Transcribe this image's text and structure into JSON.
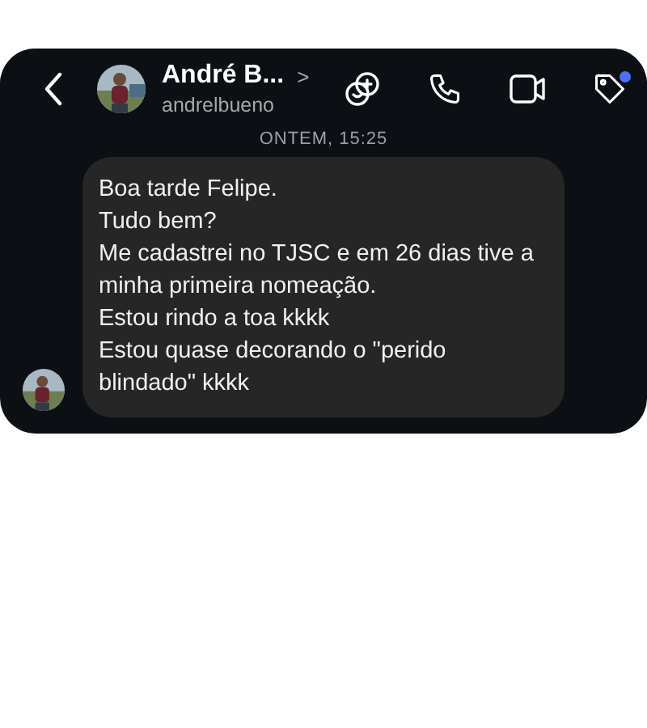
{
  "header": {
    "name": "André B...",
    "chevron": ">",
    "username": "andrelbueno",
    "tag_notification": true
  },
  "timestamp": "ONTEM, 15:25",
  "message": {
    "lines": [
      "Boa tarde Felipe.",
      "Tudo bem?",
      "Me cadastrei no TJSC e em 26 dias tive a minha primeira nomeação.",
      "Estou rindo a toa kkkk",
      "Estou quase decorando o \"perido blindado\" kkkk"
    ]
  }
}
